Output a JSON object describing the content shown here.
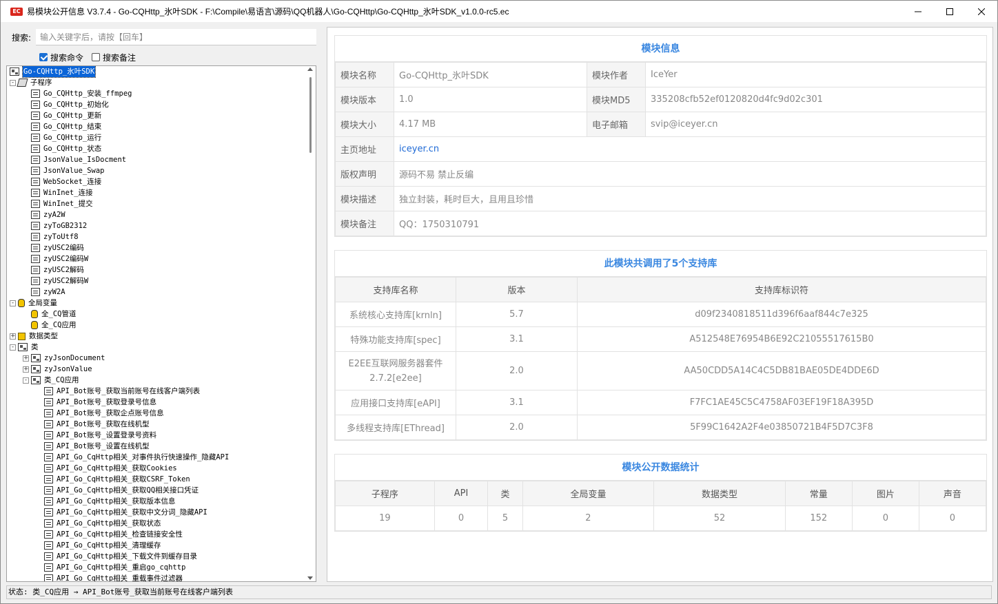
{
  "titlebar": {
    "icon_text": "EC",
    "title": "易模块公开信息 V3.7.4 - Go-CQHttp_氷叶SDK - F:\\Compile\\易语言\\源码\\QQ机器人\\Go-CQHttp\\Go-CQHttp_氷叶SDK_v1.0.0-rc5.ec"
  },
  "search": {
    "label": "搜索:",
    "placeholder": "输入关键字后，请按【回车】",
    "value": "",
    "opt_command": "搜索命令",
    "opt_command_checked": true,
    "opt_remark": "搜索备注",
    "opt_remark_checked": false
  },
  "tree": {
    "root": "Go-CQHttp_氷叶SDK",
    "subprograms_label": "子程序",
    "subprograms": [
      "Go_CQHttp_安装_ffmpeg",
      "Go_CQHttp_初始化",
      "Go_CQHttp_更新",
      "Go_CQHttp_结束",
      "Go_CQHttp_运行",
      "Go_CQHttp_状态",
      "JsonValue_IsDocment",
      "JsonValue_Swap",
      "WebSocket_连接",
      "WinInet_连接",
      "WinInet_提交",
      "zyA2W",
      "zyToGB2312",
      "zyToUtf8",
      "zyUSC2编码",
      "zyUSC2编码W",
      "zyUSC2解码",
      "zyUSC2解码W",
      "zyW2A"
    ],
    "globals_label": "全局变量",
    "globals": [
      "全_CQ管道",
      "全_CQ应用"
    ],
    "datatypes_label": "数据类型",
    "classes_label": "类",
    "classes": [
      "zyJsonDocument",
      "zyJsonValue",
      "类_CQ应用"
    ],
    "methods": [
      "API_Bot账号_获取当前账号在线客户端列表",
      "API_Bot账号_获取登录号信息",
      "API_Bot账号_获取企点账号信息",
      "API_Bot账号_获取在线机型",
      "API_Bot账号_设置登录号资料",
      "API_Bot账号_设置在线机型",
      "API_Go_CqHttp相关_对事件执行快速操作_隐藏API",
      "API_Go_CqHttp相关_获取Cookies",
      "API_Go_CqHttp相关_获取CSRF_Token",
      "API_Go_CqHttp相关_获取QQ相关接口凭证",
      "API_Go_CqHttp相关_获取版本信息",
      "API_Go_CqHttp相关_获取中文分词_隐藏API",
      "API_Go_CqHttp相关_获取状态",
      "API_Go_CqHttp相关_检查链接安全性",
      "API_Go_CqHttp相关_清理缓存",
      "API_Go_CqHttp相关_下载文件到缓存目录",
      "API_Go_CqHttp相关_重启go_cqhttp",
      "API_Go_CqHttp相关_重载事件过滤器"
    ]
  },
  "status": {
    "text": "状态: 类_CQ应用 → API_Bot账号_获取当前账号在线客户端列表"
  },
  "module_info": {
    "title": "模块信息",
    "rows": [
      {
        "k1": "模块名称",
        "v1": "Go-CQHttp_氷叶SDK",
        "k2": "模块作者",
        "v2": "IceYer"
      },
      {
        "k1": "模块版本",
        "v1": "1.0",
        "k2": "模块MD5",
        "v2": "335208cfb52ef0120820d4fc9d02c301"
      },
      {
        "k1": "模块大小",
        "v1": "4.17 MB",
        "k2": "电子邮箱",
        "v2": "svip@iceyer.cn"
      }
    ],
    "homepage_key": "主页地址",
    "homepage_val": "iceyer.cn",
    "copyright_key": "版权声明",
    "copyright_val": "源码不易 禁止反编",
    "desc_key": "模块描述",
    "desc_val": "独立封装，耗时巨大，且用且珍惜",
    "remark_key": "模块备注",
    "remark_val": "QQ：1750310791"
  },
  "libs": {
    "title": "此模块共调用了5个支持库",
    "headers": [
      "支持库名称",
      "版本",
      "支持库标识符"
    ],
    "rows": [
      [
        "系统核心支持库[krnln]",
        "5.7",
        "d09f2340818511d396f6aaf844c7e325"
      ],
      [
        "特殊功能支持库[spec]",
        "3.1",
        "A512548E76954B6E92C21055517615B0"
      ],
      [
        "E2EE互联网服务器套件2.7.2[e2ee]",
        "2.0",
        "AA50CDD5A14C4C5DB81BAE05DE4DDE6D"
      ],
      [
        "应用接口支持库[eAPI]",
        "3.1",
        "F7FC1AE45C5C4758AF03EF19F18A395D"
      ],
      [
        "多线程支持库[EThread]",
        "2.0",
        "5F99C1642A2F4e03850721B4F5D7C3F8"
      ]
    ]
  },
  "stats": {
    "title": "模块公开数据统计",
    "headers": [
      "子程序",
      "API",
      "类",
      "全局变量",
      "数据类型",
      "常量",
      "图片",
      "声音"
    ],
    "values": [
      "19",
      "0",
      "5",
      "2",
      "52",
      "152",
      "0",
      "0"
    ]
  },
  "colors": {
    "accent": "#3a87e0",
    "link": "#1f6ad6",
    "selection": "#0a64d8"
  }
}
